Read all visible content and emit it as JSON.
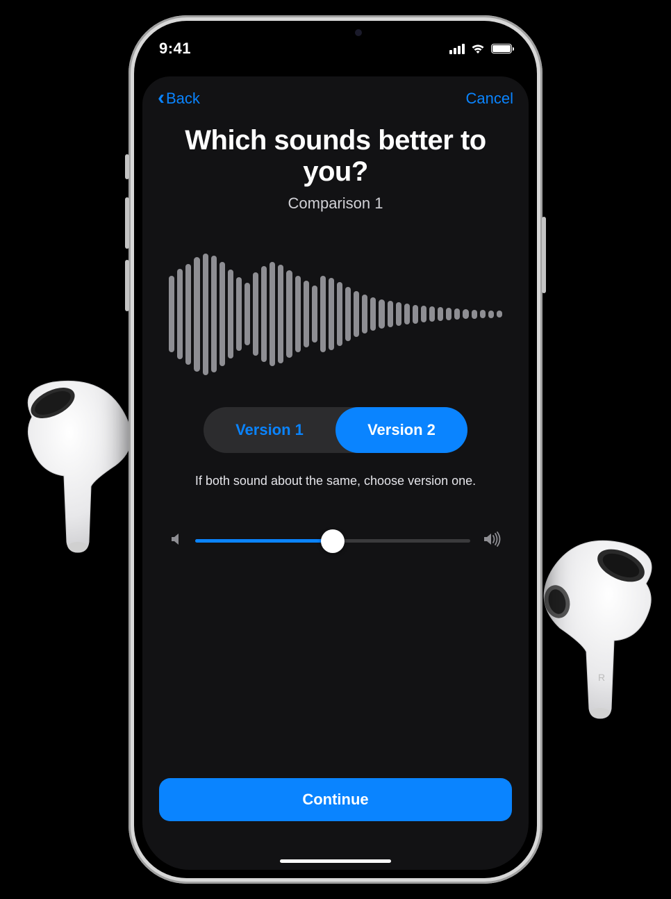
{
  "status": {
    "time": "9:41"
  },
  "nav": {
    "back_label": "Back",
    "cancel_label": "Cancel"
  },
  "title": "Which sounds better to you?",
  "subtitle": "Comparison 1",
  "segment": {
    "option1": "Version 1",
    "option2": "Version 2",
    "selected": 2
  },
  "helper": "If both sound about the same, choose version one.",
  "volume": {
    "value_percent": 50
  },
  "continue_label": "Continue",
  "waveform_heights": [
    110,
    130,
    145,
    165,
    175,
    168,
    150,
    128,
    106,
    90,
    120,
    138,
    150,
    142,
    126,
    110,
    96,
    82,
    110,
    104,
    92,
    78,
    66,
    56,
    48,
    42,
    38,
    34,
    30,
    27,
    24,
    22,
    20,
    18,
    16,
    14,
    13,
    12,
    11,
    10
  ],
  "colors": {
    "accent": "#0a84ff"
  }
}
